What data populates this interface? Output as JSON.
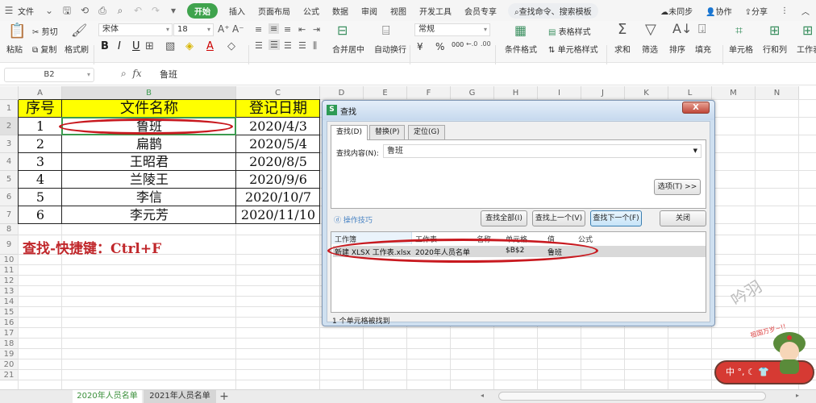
{
  "menubar": {
    "file_label": "文件",
    "tabs": [
      "开始",
      "插入",
      "页面布局",
      "公式",
      "数据",
      "审阅",
      "视图",
      "开发工具",
      "会员专享"
    ],
    "search_placeholder": "查找命令、搜索模板",
    "sync_label": "未同步",
    "collab_label": "协作",
    "share_label": "分享"
  },
  "ribbon": {
    "paste": "粘贴",
    "cut": "剪切",
    "copy": "复制",
    "format_painter": "格式刷",
    "font_name": "宋体",
    "font_size": "18",
    "merge_center": "合并居中",
    "wrap_text": "自动换行",
    "number_format": "常规",
    "conditional_format": "条件格式",
    "table_style": "表格样式",
    "cell_style": "单元格样式",
    "sum": "求和",
    "filter": "筛选",
    "sort": "排序",
    "fill": "填充",
    "cell": "单元格",
    "row_col": "行和列",
    "worksheet": "工作表",
    "currency_symbol": "¥",
    "percent_symbol": "%",
    "thousands": "000"
  },
  "formula_bar": {
    "name_box": "B2",
    "fx_label": "fx",
    "value": "鲁班"
  },
  "sheet": {
    "columns": [
      "A",
      "B",
      "C",
      "D",
      "E",
      "F",
      "G",
      "H",
      "I",
      "J",
      "K",
      "L",
      "M",
      "N"
    ],
    "rows": [
      "1",
      "2",
      "3",
      "4",
      "5",
      "6",
      "7",
      "8",
      "9",
      "10",
      "11",
      "12",
      "13",
      "14",
      "15",
      "16",
      "17",
      "18",
      "19",
      "20",
      "21"
    ],
    "header": [
      "序号",
      "文件名称",
      "登记日期"
    ],
    "data": [
      [
        "1",
        "鲁班",
        "2020/4/3"
      ],
      [
        "2",
        "扁鹊",
        "2020/5/4"
      ],
      [
        "3",
        "王昭君",
        "2020/8/5"
      ],
      [
        "4",
        "兰陵王",
        "2020/9/6"
      ],
      [
        "5",
        "李信",
        "2020/10/7"
      ],
      [
        "6",
        "李元芳",
        "2020/11/10"
      ]
    ],
    "note": "查找-快捷键：Ctrl+F"
  },
  "dialog": {
    "title": "查找",
    "close_label": "X",
    "tabs": [
      "查找(D)",
      "替换(P)",
      "定位(G)"
    ],
    "find_label": "查找内容(N):",
    "find_value": "鲁班",
    "options_button": "选项(T) >>",
    "tips_link": "操作技巧",
    "find_all": "查找全部(I)",
    "find_prev": "查找上一个(V)",
    "find_next": "查找下一个(F)",
    "close_button": "关闭",
    "result_headers": [
      "工作簿",
      "工作表",
      "名称",
      "单元格",
      "值",
      "公式"
    ],
    "result_row": [
      "新建 XLSX 工作表.xlsx",
      "2020年人员名单",
      "",
      "$B$2",
      "鲁班",
      ""
    ],
    "status": "1 个单元格被找到"
  },
  "sheet_tabs": [
    "2020年人员名单",
    "2021年人员名单"
  ],
  "add_sheet": "+",
  "overlay": {
    "watermark": "吟羽",
    "slogan": "祖国万岁~!!",
    "ime_label": "中"
  },
  "colors": {
    "accent_green": "#3fa34d",
    "header_yellow": "#ffff00",
    "annotation_red": "#c8191f"
  }
}
